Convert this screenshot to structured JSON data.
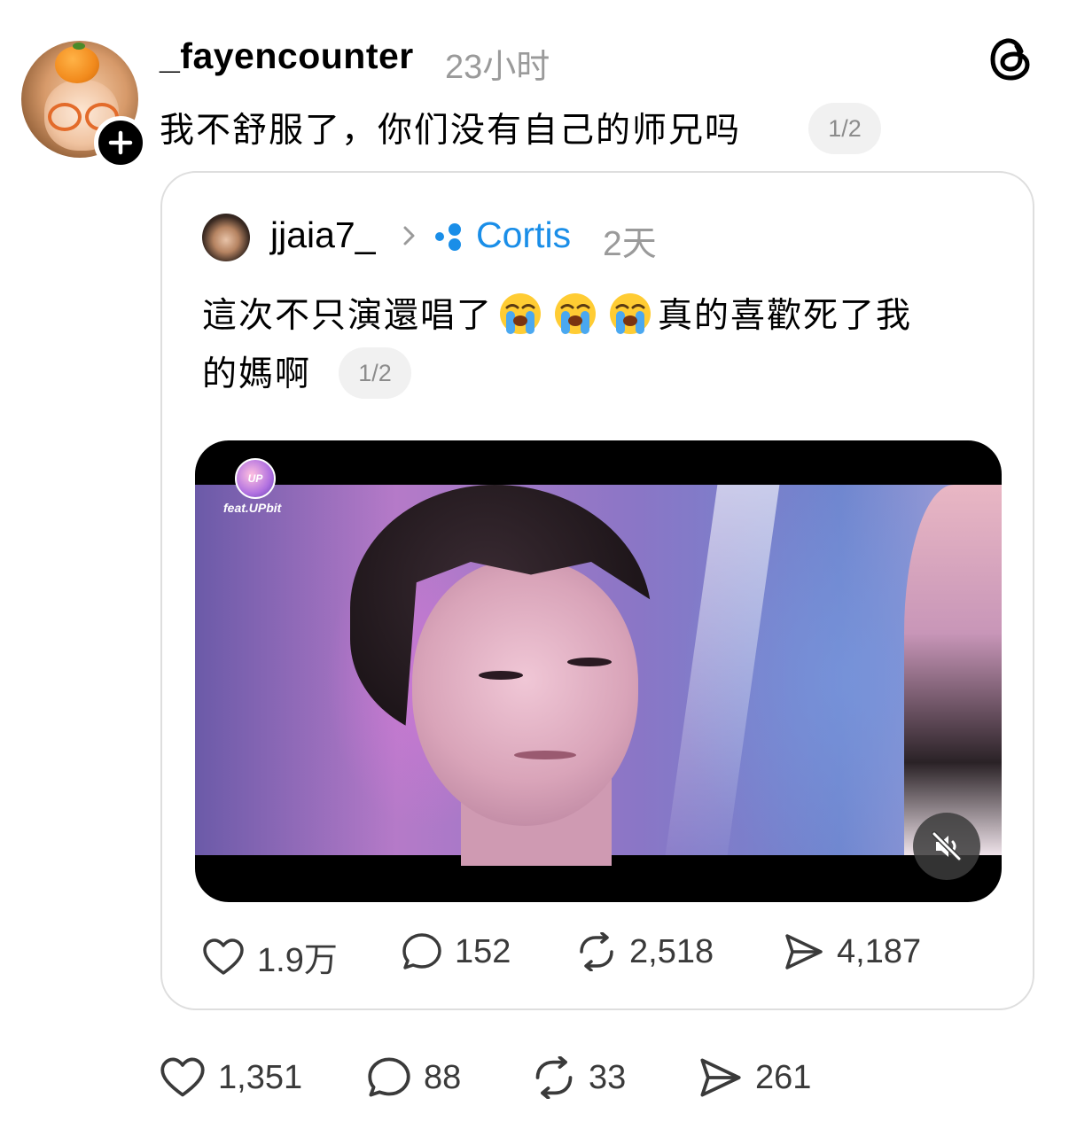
{
  "post": {
    "username": "_fayencounter",
    "time": "23小时",
    "text": "我不舒服了，你们没有自己的师兄吗",
    "page_indicator": "1/2",
    "stats": {
      "likes": "1,351",
      "replies": "88",
      "reposts": "33",
      "shares": "261"
    }
  },
  "quoted": {
    "username": "jjaia7_",
    "community": "Cortis",
    "time": "2天",
    "text_line1": "這次不只演還唱了",
    "text_line1_end": "真的喜歡死了我",
    "text_line2": "的媽啊",
    "page_indicator": "1/2",
    "video": {
      "badge_text": "UP",
      "watermark": "feat.UPbit",
      "muted": true
    },
    "stats": {
      "likes": "1.9万",
      "replies": "152",
      "reposts": "2,518",
      "shares": "4,187"
    }
  },
  "icons": {
    "follow": "plus-icon",
    "app_logo": "threads-logo-icon",
    "chevron": "chevron-right-icon",
    "community": "community-dots-icon",
    "emoji": "loudly-crying-face-emoji",
    "like": "heart-icon",
    "reply": "comment-bubble-icon",
    "repost": "repost-icon",
    "share": "send-icon",
    "mute": "speaker-muted-icon"
  },
  "colors": {
    "community_link": "#1a8ee8",
    "muted_text": "#9a9a9a",
    "card_border": "#dedede"
  }
}
